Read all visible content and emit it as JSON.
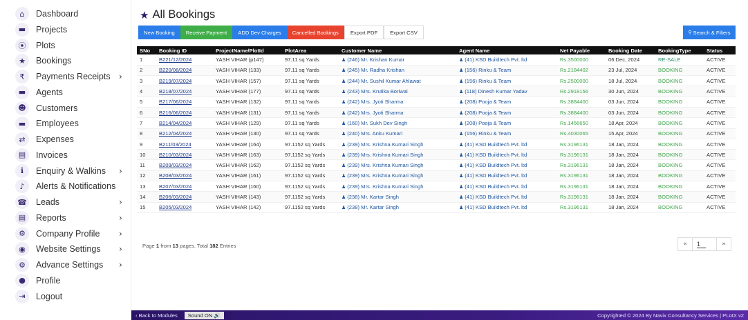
{
  "sidebar": {
    "items": [
      {
        "label": "Dashboard",
        "icon": "home-icon",
        "glyph": "⌂",
        "chevron": ""
      },
      {
        "label": "Projects",
        "icon": "briefcase-icon",
        "glyph": "▬",
        "chevron": ""
      },
      {
        "label": "Plots",
        "icon": "map-pin-icon",
        "glyph": "⦿",
        "chevron": ""
      },
      {
        "label": "Bookings",
        "icon": "star-icon",
        "glyph": "★",
        "chevron": ""
      },
      {
        "label": "Payments Receipts",
        "icon": "rupee-icon",
        "glyph": "₹",
        "chevron": "›"
      },
      {
        "label": "Agents",
        "icon": "briefcase-icon",
        "glyph": "▬",
        "chevron": ""
      },
      {
        "label": "Customers",
        "icon": "users-icon",
        "glyph": "☻",
        "chevron": ""
      },
      {
        "label": "Employees",
        "icon": "briefcase-icon",
        "glyph": "▬",
        "chevron": ""
      },
      {
        "label": "Expenses",
        "icon": "exchange-icon",
        "glyph": "⇄",
        "chevron": ""
      },
      {
        "label": "Invoices",
        "icon": "pdf-file-icon",
        "glyph": "▤",
        "chevron": ""
      },
      {
        "label": "Enquiry & Walkins",
        "icon": "info-icon",
        "glyph": "ℹ",
        "chevron": "›"
      },
      {
        "label": "Alerts & Notifications",
        "icon": "bell-icon",
        "glyph": "♪",
        "chevron": ""
      },
      {
        "label": "Leads",
        "icon": "phone-icon",
        "glyph": "☎",
        "chevron": "›"
      },
      {
        "label": "Reports",
        "icon": "pdf-file-icon",
        "glyph": "▤",
        "chevron": "›"
      },
      {
        "label": "Company Profile",
        "icon": "gear-icon",
        "glyph": "⚙",
        "chevron": "›"
      },
      {
        "label": "Website Settings",
        "icon": "globe-icon",
        "glyph": "◉",
        "chevron": "›"
      },
      {
        "label": "Advance Settings",
        "icon": "gears-icon",
        "glyph": "⚙",
        "chevron": "›"
      },
      {
        "label": "Profile",
        "icon": "user-icon",
        "glyph": "●",
        "chevron": ""
      },
      {
        "label": "Logout",
        "icon": "logout-icon",
        "glyph": "⇥",
        "chevron": ""
      }
    ]
  },
  "page": {
    "title": "All Bookings",
    "title_icon": "star-icon"
  },
  "toolbar": {
    "new_booking": "New Booking",
    "receive_payment": "Receive Payment",
    "add_dev_charges": "ADD Dev Charges",
    "cancelled_bookings": "Cancelled Bookings",
    "export_pdf": "Export PDF",
    "export_csv": "Export CSV",
    "search_filters": "Search & Filters",
    "search_icon": "search-icon"
  },
  "table": {
    "headers": [
      "SNo",
      "Booking ID",
      "ProjectName/PlotId",
      "PlotArea",
      "Customer Name",
      "Agent Name",
      "Net Payable",
      "Booking Date",
      "BookingType",
      "Status"
    ],
    "rows": [
      {
        "sno": "1",
        "booking_id": "B221/12/2024",
        "project": "YASH VIHAR (p147)",
        "area": "97.11 sq Yards",
        "customer": "(246) Mr. Krishan Kumar",
        "agent": "(41) KSD Buildtech Pvt. ltd",
        "net": "Rs.3500000",
        "date": "06 Dec, 2024",
        "type": "RE-SALE",
        "status": "ACTIVE"
      },
      {
        "sno": "2",
        "booking_id": "B220/08/2024",
        "project": "YASH VIHAR (133)",
        "area": "97.11 sq Yards",
        "customer": "(245) Mr. Radha Krishan",
        "agent": "(156) Rinku & Team",
        "net": "Rs.2184402",
        "date": "23 Jul, 2024",
        "type": "BOOKING",
        "status": "ACTIVE"
      },
      {
        "sno": "3",
        "booking_id": "B219/07/2024",
        "project": "YASH VIHAR (157)",
        "area": "97.11 sq Yards",
        "customer": "(244) Mr. Sushil Kumar Ahlawat",
        "agent": "(156) Rinku & Team",
        "net": "Rs.2500000",
        "date": "18 Jul, 2024",
        "type": "BOOKING",
        "status": "ACTIVE"
      },
      {
        "sno": "4",
        "booking_id": "B218/07/2024",
        "project": "YASH VIHAR (177)",
        "area": "97.11 sq Yards",
        "customer": "(243) Mrs. Krutika Boriwal",
        "agent": "(118) Dinesh Kumar Yadav",
        "net": "Rs.2918156",
        "date": "30 Jun, 2024",
        "type": "BOOKING",
        "status": "ACTIVE"
      },
      {
        "sno": "5",
        "booking_id": "B217/06/2024",
        "project": "YASH VIHAR (132)",
        "area": "97.11 sq Yards",
        "customer": "(242) Mrs. Jyoti Sharma",
        "agent": "(208) Pooja & Team",
        "net": "Rs.3884400",
        "date": "03 Jun, 2024",
        "type": "BOOKING",
        "status": "ACTIVE"
      },
      {
        "sno": "6",
        "booking_id": "B216/06/2024",
        "project": "YASH VIHAR (131)",
        "area": "97.11 sq Yards",
        "customer": "(242) Mrs. Jyoti Sharma",
        "agent": "(208) Pooja & Team",
        "net": "Rs.3884400",
        "date": "03 Jun, 2024",
        "type": "BOOKING",
        "status": "ACTIVE"
      },
      {
        "sno": "7",
        "booking_id": "B214/04/2024",
        "project": "YASH VIHAR (129)",
        "area": "97.11 sq Yards",
        "customer": "(160) Mr. Sukh Dev Singh",
        "agent": "(208) Pooja & Team",
        "net": "Rs.1456650",
        "date": "18 Apr, 2024",
        "type": "BOOKING",
        "status": "ACTIVE"
      },
      {
        "sno": "8",
        "booking_id": "B212/04/2024",
        "project": "YASH VIHAR (130)",
        "area": "97.11 sq Yards",
        "customer": "(240) Mrs. Anku Kumari",
        "agent": "(156) Rinku & Team",
        "net": "Rs.4030065",
        "date": "15 Apr, 2024",
        "type": "BOOKING",
        "status": "ACTIVE"
      },
      {
        "sno": "9",
        "booking_id": "B211/03/2024",
        "project": "YASH VIHAR (164)",
        "area": "97.1152 sq Yards",
        "customer": "(239) Mrs. Krishna Kumari Singh",
        "agent": "(41) KSD Buildtech Pvt. ltd",
        "net": "Rs.3196131",
        "date": "18 Jan, 2024",
        "type": "BOOKING",
        "status": "ACTIVE"
      },
      {
        "sno": "10",
        "booking_id": "B210/03/2024",
        "project": "YASH VIHAR (163)",
        "area": "97.1152 sq Yards",
        "customer": "(239) Mrs. Krishna Kumari Singh",
        "agent": "(41) KSD Buildtech Pvt. ltd",
        "net": "Rs.3196131",
        "date": "18 Jan, 2024",
        "type": "BOOKING",
        "status": "ACTIVE"
      },
      {
        "sno": "11",
        "booking_id": "B209/03/2024",
        "project": "YASH VIHAR (162)",
        "area": "97.1152 sq Yards",
        "customer": "(239) Mrs. Krishna Kumari Singh",
        "agent": "(41) KSD Buildtech Pvt. ltd",
        "net": "Rs.3196131",
        "date": "18 Jan, 2024",
        "type": "BOOKING",
        "status": "ACTIVE"
      },
      {
        "sno": "12",
        "booking_id": "B208/03/2024",
        "project": "YASH VIHAR (161)",
        "area": "97.1152 sq Yards",
        "customer": "(239) Mrs. Krishna Kumari Singh",
        "agent": "(41) KSD Buildtech Pvt. ltd",
        "net": "Rs.3196131",
        "date": "18 Jan, 2024",
        "type": "BOOKING",
        "status": "ACTIVE"
      },
      {
        "sno": "13",
        "booking_id": "B207/03/2024",
        "project": "YASH VIHAR (160)",
        "area": "97.1152 sq Yards",
        "customer": "(239) Mrs. Krishna Kumari Singh",
        "agent": "(41) KSD Buildtech Pvt. ltd",
        "net": "Rs.3196131",
        "date": "18 Jan, 2024",
        "type": "BOOKING",
        "status": "ACTIVE"
      },
      {
        "sno": "14",
        "booking_id": "B206/03/2024",
        "project": "YASH VIHAR (143)",
        "area": "97.1152 sq Yards",
        "customer": "(238) Mr. Kartar Singh",
        "agent": "(41) KSD Buildtech Pvt. ltd",
        "net": "Rs.3196131",
        "date": "18 Jan, 2024",
        "type": "BOOKING",
        "status": "ACTIVE"
      },
      {
        "sno": "15",
        "booking_id": "B205/03/2024",
        "project": "YASH VIHAR (142)",
        "area": "97.1152 sq Yards",
        "customer": "(238) Mr. Kartar Singh",
        "agent": "(41) KSD Buildtech Pvt. ltd",
        "net": "Rs.3196131",
        "date": "18 Jan, 2024",
        "type": "BOOKING",
        "status": "ACTIVE"
      }
    ]
  },
  "pagination": {
    "prefix": "Page",
    "current": "1",
    "from_text": "from",
    "total_pages": "13",
    "pages_text": "pages. Total",
    "total_entries": "182",
    "entries_text": "Entries",
    "prev": "«",
    "next": "»"
  },
  "footer": {
    "back_label": "‹ Back to Modules",
    "sound_label": "Sound ON 🔊",
    "copyright": "Copyrighted © 2024 By Navix Consultancy Services | PLotX v2"
  },
  "colors": {
    "accent": "#2e1a6e",
    "blue": "#2b7de9",
    "green": "#3fae49",
    "red": "#e8432e"
  }
}
